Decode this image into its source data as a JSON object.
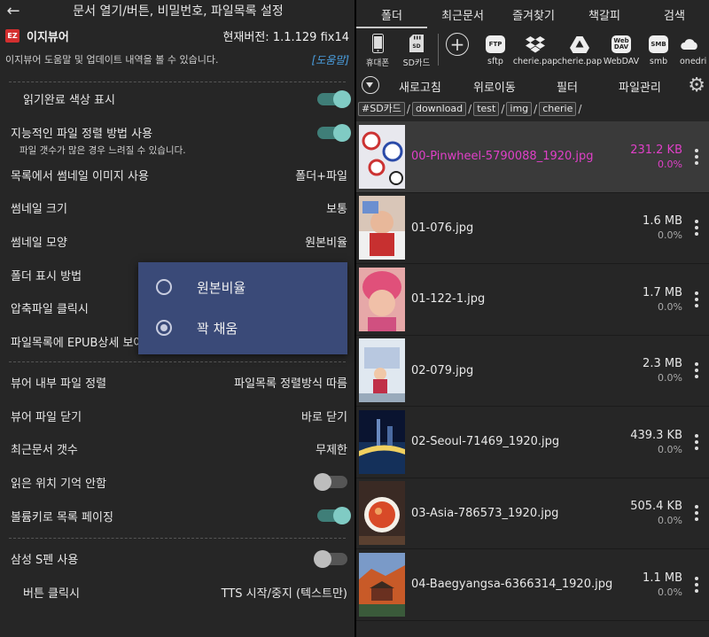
{
  "left": {
    "header_title": "문서 열기/버튼, 비밀번호, 파일목록 설정",
    "app_logo_text": "EZ",
    "app_name": "이지뷰어",
    "version": "현재버전: 1.1.129 fix14",
    "help_text": "이지뷰어 도움말 및 업데이트 내역을 볼 수 있습니다.",
    "help_link": "[도움말]",
    "settings_a": [
      {
        "label": "읽기완료 색상 표시",
        "toggle": "on",
        "indent": true
      },
      {
        "label": "지능적인 파일 정렬 방법 사용",
        "toggle": "on"
      },
      {
        "note": "파일 갯수가 많은 경우 느려질 수 있습니다."
      },
      {
        "label": "목록에서 썸네일 이미지 사용",
        "value": "폴더+파일"
      },
      {
        "label": "썸네일 크기",
        "value": "보통"
      },
      {
        "label": "썸네일 모양",
        "value": "원본비율"
      },
      {
        "label": "폴더 표시 방법",
        "value": ""
      },
      {
        "label": "압축파일 클릭시",
        "value": ""
      },
      {
        "label": "파일목록에 EPUB상세 보여",
        "value": ""
      }
    ],
    "settings_b": [
      {
        "label": "뷰어 내부 파일 정렬",
        "value": "파일목록 정렬방식 따름"
      },
      {
        "label": "뷰어 파일 닫기",
        "value": "바로 닫기"
      },
      {
        "label": "최근문서 갯수",
        "value": "무제한"
      },
      {
        "label": "읽은 위치 기억 안함",
        "toggle": "off"
      },
      {
        "label": "볼륨키로 목록 페이징",
        "toggle": "on"
      }
    ],
    "settings_c": [
      {
        "label": "삼성 S펜 사용",
        "toggle": "off"
      },
      {
        "label": "버튼 클릭시",
        "value": "TTS 시작/중지 (텍스트만)",
        "indent": true
      }
    ],
    "popup": {
      "options": [
        {
          "label": "원본비율",
          "selected": false
        },
        {
          "label": "꽉 채움",
          "selected": true
        }
      ]
    }
  },
  "right": {
    "tabs": [
      "폴더",
      "최근문서",
      "즐겨찾기",
      "책갈피",
      "검색"
    ],
    "storage": [
      {
        "label": "휴대폰",
        "icon": "phone-icon"
      },
      {
        "label": "SD카드",
        "icon": "sdcard-icon"
      }
    ],
    "cloud": [
      {
        "label": "sftp",
        "badge": "FTP",
        "icon": "ftp-icon"
      },
      {
        "label": "cherie.pap",
        "icon": "dropbox-icon"
      },
      {
        "label": "cherie.pap",
        "icon": "google-drive-icon"
      },
      {
        "label": "WebDAV",
        "badge": "Web DAV",
        "icon": "webdav-icon"
      },
      {
        "label": "smb",
        "badge": "SMB",
        "icon": "smb-icon"
      },
      {
        "label": "onedrive",
        "icon": "onedrive-icon"
      }
    ],
    "toolbar": [
      "새로고침",
      "위로이동",
      "필터",
      "파일관리"
    ],
    "path": [
      "#SD카드",
      "download",
      "test",
      "img",
      "cherie"
    ],
    "files": [
      {
        "name": "00-Pinwheel-5790088_1920.jpg",
        "size": "231.2 KB",
        "progress": "0.0%",
        "selected": true
      },
      {
        "name": "01-076.jpg",
        "size": "1.6 MB",
        "progress": "0.0%"
      },
      {
        "name": "01-122-1.jpg",
        "size": "1.7 MB",
        "progress": "0.0%"
      },
      {
        "name": "02-079.jpg",
        "size": "2.3 MB",
        "progress": "0.0%"
      },
      {
        "name": "02-Seoul-71469_1920.jpg",
        "size": "439.3 KB",
        "progress": "0.0%"
      },
      {
        "name": "03-Asia-786573_1920.jpg",
        "size": "505.4 KB",
        "progress": "0.0%"
      },
      {
        "name": "04-Baegyangsa-6366314_1920.jpg",
        "size": "1.1 MB",
        "progress": "0.0%"
      }
    ]
  },
  "colors": {
    "accent_toggle": "#80cbc4",
    "selected_file": "#e040c8",
    "popup_bg": "#3a4a78",
    "help_link": "#4a9fe0",
    "logo": "#d32f2f"
  }
}
